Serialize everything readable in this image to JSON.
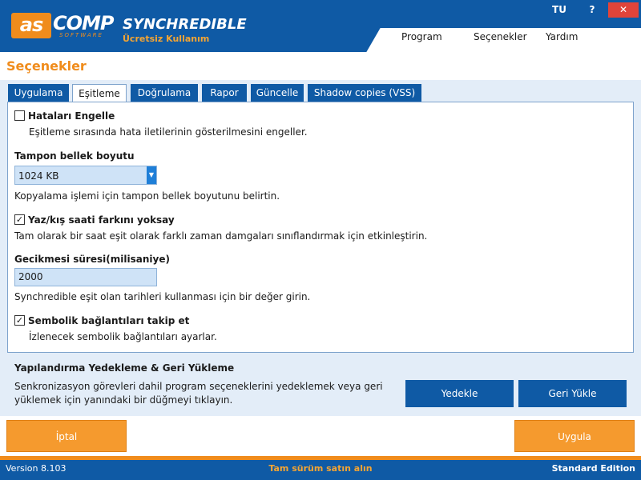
{
  "header": {
    "logo_main": "as",
    "logo_comp": "COMP",
    "logo_sub": "SOFTWARE",
    "title": "SYNCHREDIBLE",
    "subtitle": "Ücretsiz Kullanım",
    "window_controls": {
      "lang": "TU",
      "help": "?",
      "close": "✕"
    },
    "menu": [
      "Program",
      "Seçenekler",
      "Yardım"
    ]
  },
  "page_title": "Seçenekler",
  "tabs": [
    {
      "label": "Uygulama",
      "active": false
    },
    {
      "label": "Eşitleme",
      "active": true
    },
    {
      "label": "Doğrulama",
      "active": false
    },
    {
      "label": "Rapor",
      "active": false
    },
    {
      "label": "Güncelle",
      "active": false
    },
    {
      "label": "Shadow copies (VSS)",
      "active": false
    }
  ],
  "options": {
    "suppress_errors": {
      "label": "Hataları Engelle",
      "checked": false,
      "desc": "Eşitleme sırasında hata iletilerinin gösterilmesini engeller."
    },
    "buffer": {
      "label": "Tampon bellek boyutu",
      "value": "1024 KB",
      "desc": "Kopyalama işlemi için tampon bellek boyutunu belirtin."
    },
    "dst": {
      "label": "Yaz/kış saati farkını yoksay",
      "checked": true,
      "check_mark": "✓",
      "desc": "Tam olarak bir saat eşit olarak farklı zaman damgaları sınıflandırmak için etkinleştirin."
    },
    "delay": {
      "label": "Gecikmesi süresi(milisaniye)",
      "value": "2000",
      "desc": "Synchredible eşit olan tarihleri kullanması için bir değer girin."
    },
    "symlinks": {
      "label": "Sembolik bağlantıları takip et",
      "checked": true,
      "check_mark": "✓",
      "desc": "İzlenecek sembolik bağlantıları ayarlar."
    }
  },
  "backup": {
    "title": "Yapılandırma Yedekleme & Geri Yükleme",
    "desc_line1": "Senkronizasyon görevleri dahil program seçeneklerini yedeklemek veya geri",
    "desc_line2": "yüklemek için yanındaki bir düğmeyi tıklayın.",
    "backup_label": "Yedekle",
    "restore_label": "Geri Yükle"
  },
  "actions": {
    "cancel_label": "İptal",
    "apply_label": "Uygula"
  },
  "footer": {
    "version": "Version 8.103",
    "buy": "Tam sürüm satın alın",
    "edition": "Standard Edition"
  },
  "colors": {
    "brand_blue": "#0f5aa5",
    "accent_orange": "#f08c1c",
    "panel_bg": "#e3edf8"
  }
}
